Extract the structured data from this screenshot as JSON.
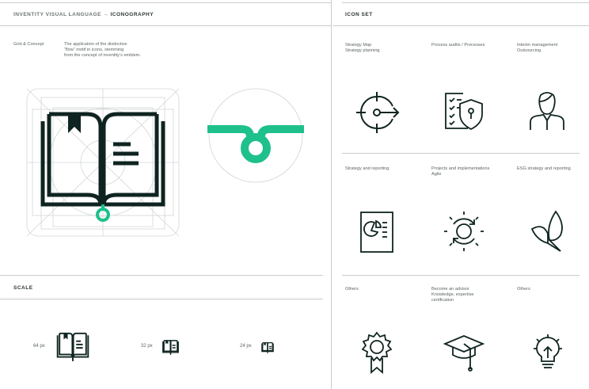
{
  "header": {
    "left_prefix": "INVENTITY VISUAL LANGUAGE → ",
    "left_title": "ICONOGRAPHY",
    "right_title": "ICON SET"
  },
  "concept": {
    "label": "Grid & Concept",
    "description_lines": [
      "The application of the distinctive",
      "“flow” motif in icons, stemming",
      "from the concept of inventity’s emblem."
    ]
  },
  "scale": {
    "title": "SCALE",
    "sizes": [
      "64 px",
      "32 px",
      "24 px"
    ]
  },
  "icon_set": [
    {
      "lines": [
        "Strategy Map",
        "Strategy planning"
      ],
      "icon": "target-arrow-icon"
    },
    {
      "lines": [
        "Process audits / Processes"
      ],
      "icon": "checklist-shield-icon"
    },
    {
      "lines": [
        "Interim management",
        "Outsourcing"
      ],
      "icon": "person-icon"
    },
    {
      "lines": [
        "Strategy and reporting"
      ],
      "icon": "report-chart-icon"
    },
    {
      "lines": [
        "Projects and implementations",
        "Agile"
      ],
      "icon": "gear-cycle-icon"
    },
    {
      "lines": [
        "ESG strategy and reporting"
      ],
      "icon": "leaves-icon"
    },
    {
      "lines": [
        "Others"
      ],
      "icon": "award-ribbon-icon"
    },
    {
      "lines": [
        "Become an advisor",
        "Knowledge, expertise",
        "certification"
      ],
      "icon": "graduation-cap-icon"
    },
    {
      "lines": [
        "Others"
      ],
      "icon": "lightbulb-icon"
    }
  ],
  "colors": {
    "ink": "#0f2420",
    "accent": "#1ec08c",
    "grid": "#cfd3d2"
  }
}
